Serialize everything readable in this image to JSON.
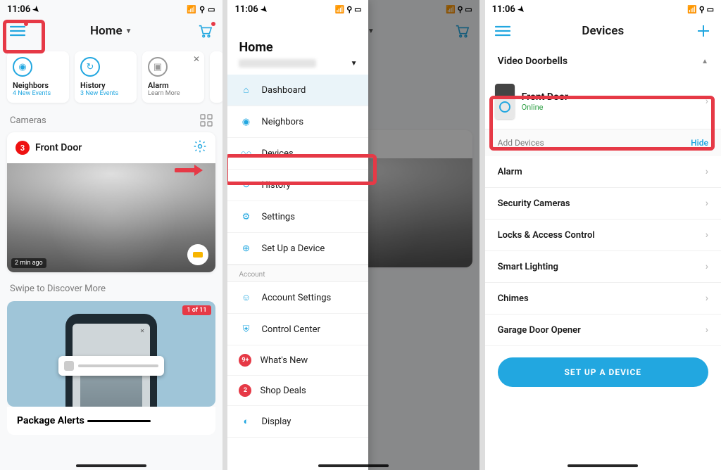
{
  "status": {
    "time": "11:06",
    "signal_text": "Signal • Wifi • Battery"
  },
  "pane1": {
    "header": {
      "title": "Home"
    },
    "cards": [
      {
        "title": "Neighbors",
        "sub": "4 New Events",
        "sub_class": "",
        "icon": "people"
      },
      {
        "title": "History",
        "sub": "3 New Events",
        "sub_class": "",
        "icon": "history"
      },
      {
        "title": "Alarm",
        "sub": "Learn More",
        "sub_class": "gray",
        "icon": "alarm",
        "close": true
      },
      {
        "title": "",
        "sub": "",
        "sub_class": "",
        "icon": ""
      }
    ],
    "section_label": "Cameras",
    "camera": {
      "badge": "3",
      "name": "Front Door",
      "timestamp": "2 min ago"
    },
    "discover": {
      "label": "Swipe to Discover More",
      "pill": "1 of 11",
      "footer": "Package Alerts"
    }
  },
  "pane2": {
    "menu_title": "Home",
    "items_top": [
      {
        "label": "Dashboard",
        "icon": "home-icon",
        "sel": true
      },
      {
        "label": "Neighbors",
        "icon": "people-icon"
      },
      {
        "label": "Devices",
        "icon": "devices-icon"
      },
      {
        "label": "History",
        "icon": "history-icon"
      },
      {
        "label": "Settings",
        "icon": "gear-icon"
      },
      {
        "label": "Set Up a Device",
        "icon": "plus-icon"
      }
    ],
    "account_label": "Account",
    "items_bottom": [
      {
        "label": "Account Settings",
        "icon": "user-icon"
      },
      {
        "label": "Control Center",
        "icon": "shield-icon"
      },
      {
        "label": "What's New",
        "icon": "badge",
        "badge": "9+"
      },
      {
        "label": "Shop Deals",
        "icon": "badge",
        "badge": "2"
      },
      {
        "label": "Display",
        "icon": "contrast-icon"
      }
    ]
  },
  "pane3": {
    "header": "Devices",
    "section": "Video Doorbells",
    "device": {
      "name": "Front Door",
      "status": "Online"
    },
    "add_label": "Add Devices",
    "hide": "Hide",
    "rows": [
      "Alarm",
      "Security Cameras",
      "Locks & Access Control",
      "Smart Lighting",
      "Chimes",
      "Garage Door Opener"
    ],
    "button": "SET UP A DEVICE"
  }
}
